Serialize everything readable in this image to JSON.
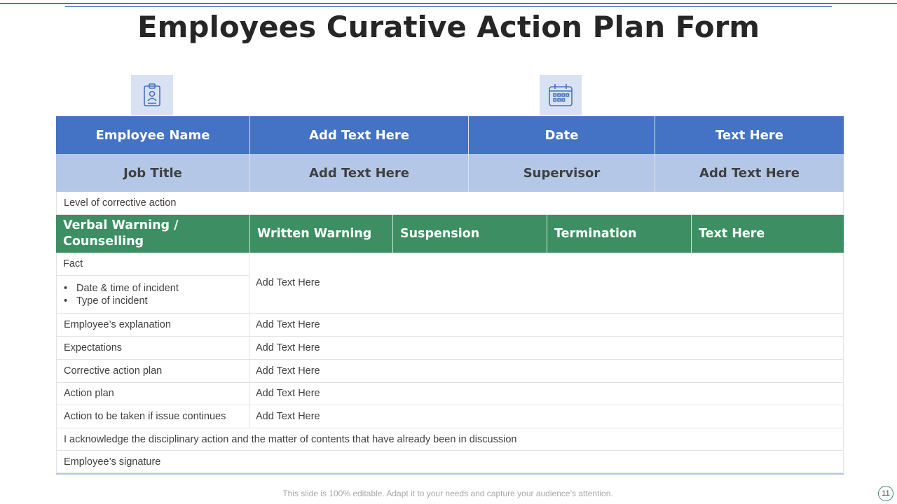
{
  "title": "Employees Curative Action Plan Form",
  "icons": {
    "left": "id-badge-icon",
    "right": "calendar-icon"
  },
  "header": [
    "Employee Name",
    "Add Text Here",
    "Date",
    "Text Here"
  ],
  "subheader": [
    "Job Title",
    "Add Text Here",
    "Supervisor",
    "Add Text Here"
  ],
  "level_label": "Level of corrective action",
  "levels": [
    "Verbal Warning / Counselling",
    "Written Warning",
    "Suspension",
    "Termination",
    "Text Here"
  ],
  "fact": {
    "label": "Fact",
    "bullets": [
      "Date & time of incident",
      "Type of incident"
    ],
    "value": "Add Text Here"
  },
  "rows": [
    {
      "label": "Employee’s explanation",
      "value": "Add Text Here"
    },
    {
      "label": "Expectations",
      "value": "Add Text Here"
    },
    {
      "label": "Corrective action plan",
      "value": "Add Text Here"
    },
    {
      "label": "Action plan",
      "value": "Add Text Here"
    },
    {
      "label": "Action to be taken if issue continues",
      "value": "Add Text Here"
    }
  ],
  "acknowledgement": "I acknowledge the disciplinary action and the matter of contents that have already been in discussion",
  "signature_label": "Employee’s signature",
  "footer": "This slide is 100% editable. Adapt it to your needs and capture your audience’s attention.",
  "page_number": "11",
  "colors": {
    "blue": "#4472c4",
    "light_blue": "#b4c7e7",
    "green": "#3d8f63",
    "icon_bg": "#d9e2f3"
  }
}
